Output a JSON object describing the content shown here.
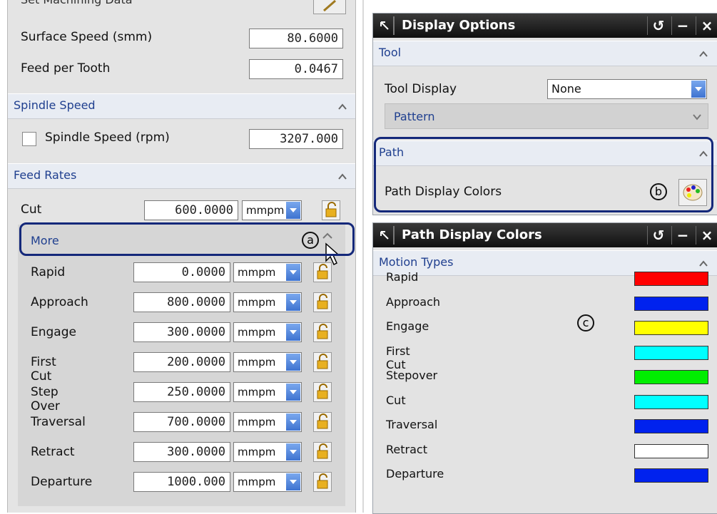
{
  "left": {
    "partial_header": "Set Machining Data",
    "surface_speed_label": "Surface Speed (smm)",
    "surface_speed_value": "80.6000",
    "feed_per_tooth_label": "Feed per Tooth",
    "feed_per_tooth_value": "0.0467",
    "spindle_section": "Spindle Speed",
    "spindle_checkbox_label": "Spindle Speed (rpm)",
    "spindle_value": "3207.000",
    "feed_section": "Feed Rates",
    "cut_label": "Cut",
    "cut_value": "600.0000",
    "cut_unit": "mmpm",
    "more_section": "More",
    "more_callout": "a",
    "rates": [
      {
        "label": "Rapid",
        "value": "0.0000",
        "unit": "mmpm"
      },
      {
        "label": "Approach",
        "value": "800.0000",
        "unit": "mmpm"
      },
      {
        "label": "Engage",
        "value": "300.0000",
        "unit": "mmpm"
      },
      {
        "label": "First Cut",
        "value": "200.0000",
        "unit": "mmpm"
      },
      {
        "label": "Step Over",
        "value": "250.0000",
        "unit": "mmpm"
      },
      {
        "label": "Traversal",
        "value": "700.0000",
        "unit": "mmpm"
      },
      {
        "label": "Retract",
        "value": "300.0000",
        "unit": "mmpm"
      },
      {
        "label": "Departure",
        "value": "1000.000",
        "unit": "mmpm"
      }
    ]
  },
  "display_options": {
    "title": "Display Options",
    "tool_section": "Tool",
    "tool_display_label": "Tool Display",
    "tool_display_value": "None",
    "pattern_section": "Pattern",
    "path_section": "Path",
    "path_colors_label": "Path Display Colors",
    "path_callout": "b"
  },
  "path_colors": {
    "title": "Path Display Colors",
    "section": "Motion Types",
    "callout": "c",
    "types": [
      {
        "label": "Rapid",
        "color": "#ff0000"
      },
      {
        "label": "Approach",
        "color": "#0022ee"
      },
      {
        "label": "Engage",
        "color": "#ffff00"
      },
      {
        "label": "First Cut",
        "color": "#00ffff"
      },
      {
        "label": "Stepover",
        "color": "#00ee00"
      },
      {
        "label": "Cut",
        "color": "#00ffff"
      },
      {
        "label": "Traversal",
        "color": "#0022ee"
      },
      {
        "label": "Retract",
        "color": "#ffffff"
      },
      {
        "label": "Departure",
        "color": "#0022ee"
      }
    ]
  },
  "titlebar_buttons": {
    "reset": "↺",
    "minimize": "−",
    "close": "×"
  }
}
